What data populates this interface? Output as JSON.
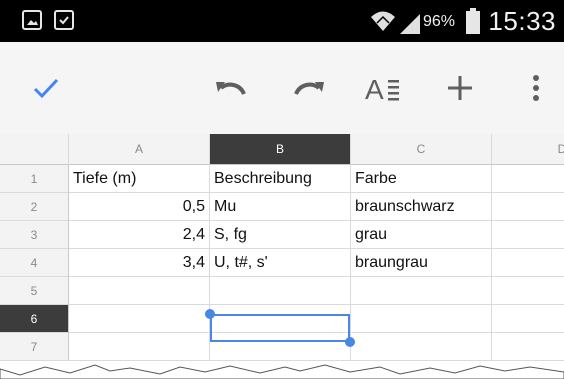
{
  "status_bar": {
    "battery_percent": "96%",
    "time": "15:33",
    "icons": [
      "image-icon",
      "save-icon",
      "wifi-icon",
      "signal-icon",
      "battery-icon"
    ]
  },
  "toolbar": {
    "buttons": [
      "check-icon",
      "undo-icon",
      "redo-icon",
      "text-format-icon",
      "add-icon",
      "more-vert-icon"
    ],
    "accent": "#4285f4"
  },
  "sheet": {
    "column_headers": [
      "A",
      "B",
      "C",
      "D"
    ],
    "selected_column": "B",
    "row_headers": [
      "1",
      "2",
      "3",
      "4",
      "5",
      "6",
      "7"
    ],
    "selected_row": "6",
    "rows": [
      [
        "Tiefe (m)",
        "Beschreibung",
        "Farbe",
        ""
      ],
      [
        "0,5",
        "Mu",
        "braunschwarz",
        ""
      ],
      [
        "2,4",
        "S, fg",
        "grau",
        ""
      ],
      [
        "3,4",
        "U, t#, s'",
        "braungrau",
        ""
      ],
      [
        "",
        "",
        "",
        ""
      ],
      [
        "",
        "",
        "",
        ""
      ],
      [
        "",
        "",
        "",
        ""
      ]
    ],
    "selection_color": "#4a86e8",
    "header_selected_bg": "#3c3c3c"
  }
}
